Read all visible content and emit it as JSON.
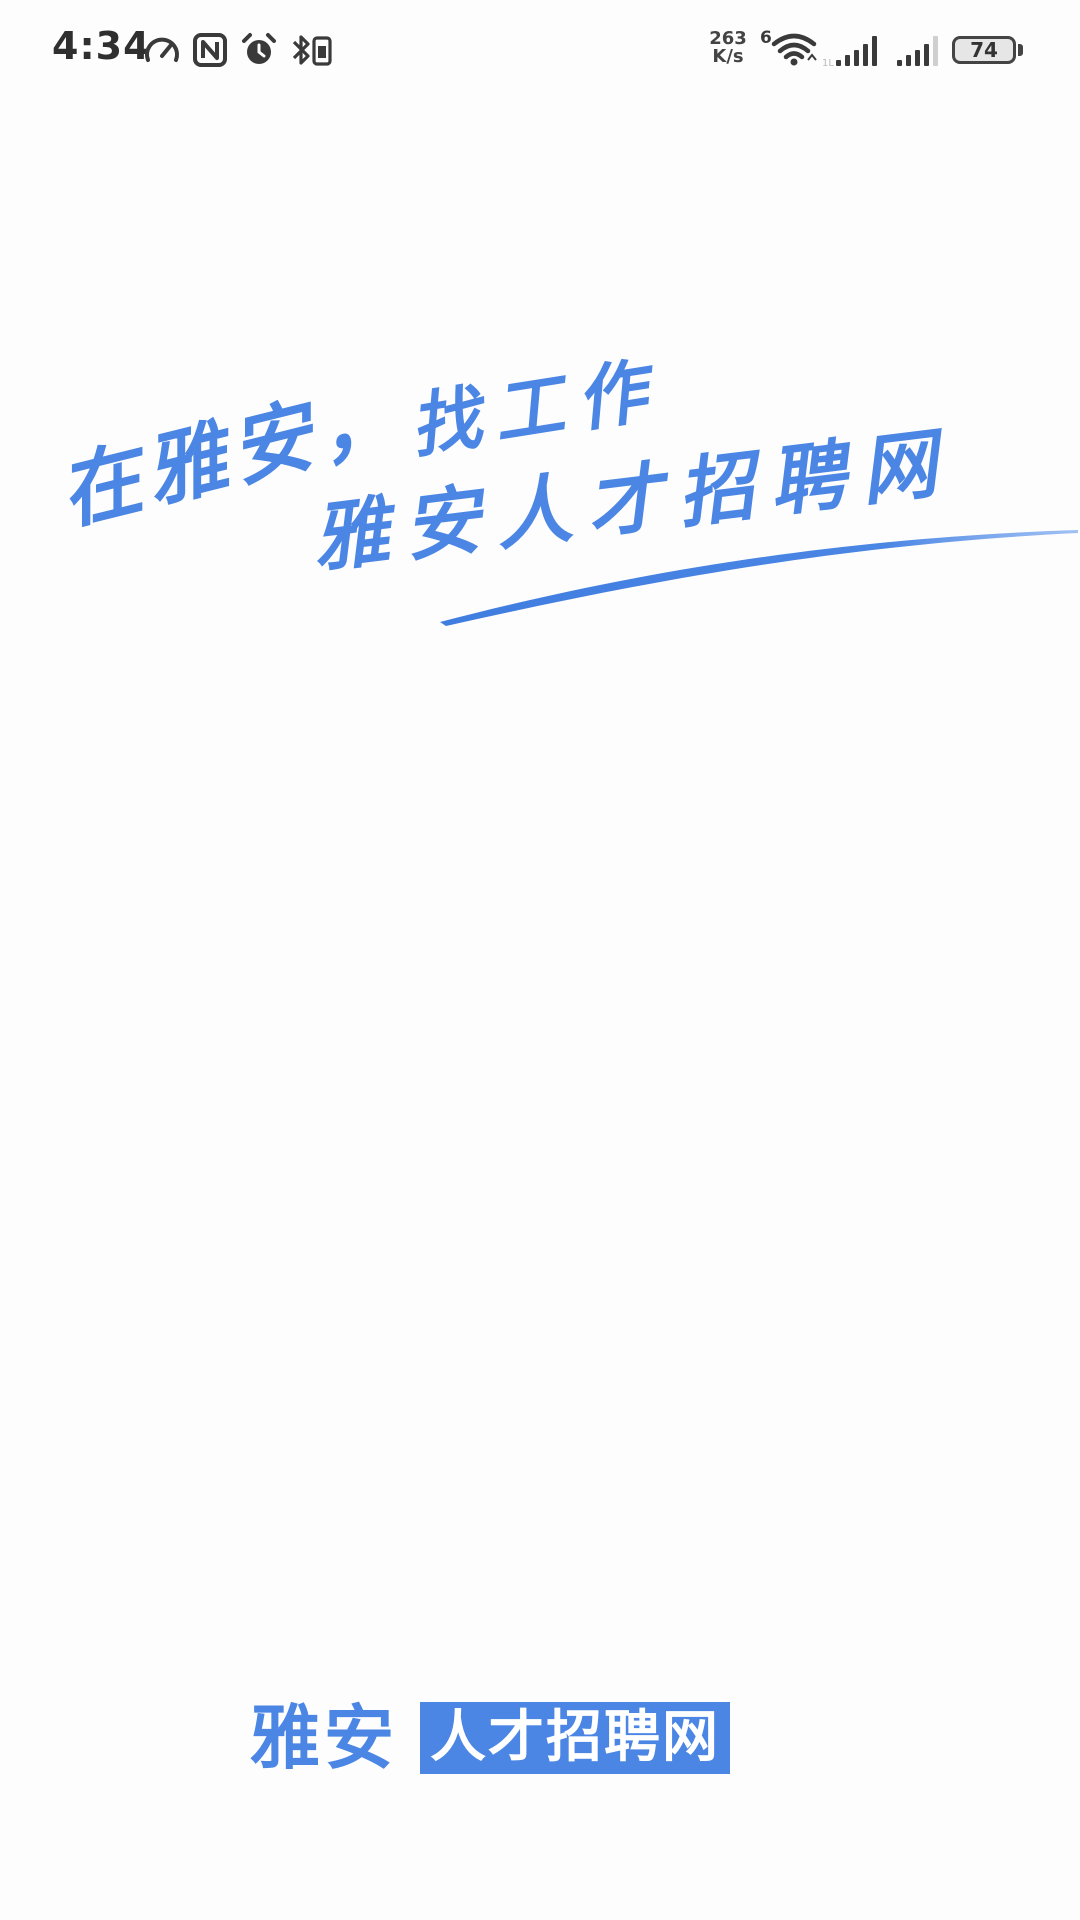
{
  "status_bar": {
    "time": "4:34",
    "net_speed_value": "263",
    "net_speed_unit": "K/s",
    "wifi_badge": "6",
    "battery": "74",
    "icons": [
      "speed-gauge-icon",
      "nfc-icon",
      "alarm-icon",
      "bluetooth-icon",
      "wifi-6-icon",
      "cellular-signal-icon",
      "cellular-signal-icon",
      "battery-icon"
    ]
  },
  "slogan": {
    "line1": "在雅安，",
    "line2": "找工作",
    "line3": "雅安人才招聘网"
  },
  "logo": {
    "left_text": "雅安",
    "right_text": "人才招聘网"
  },
  "colors": {
    "brand_blue": "#4b86e4",
    "status_icons": "#3a3a3a",
    "background": "#fdfdfd"
  }
}
